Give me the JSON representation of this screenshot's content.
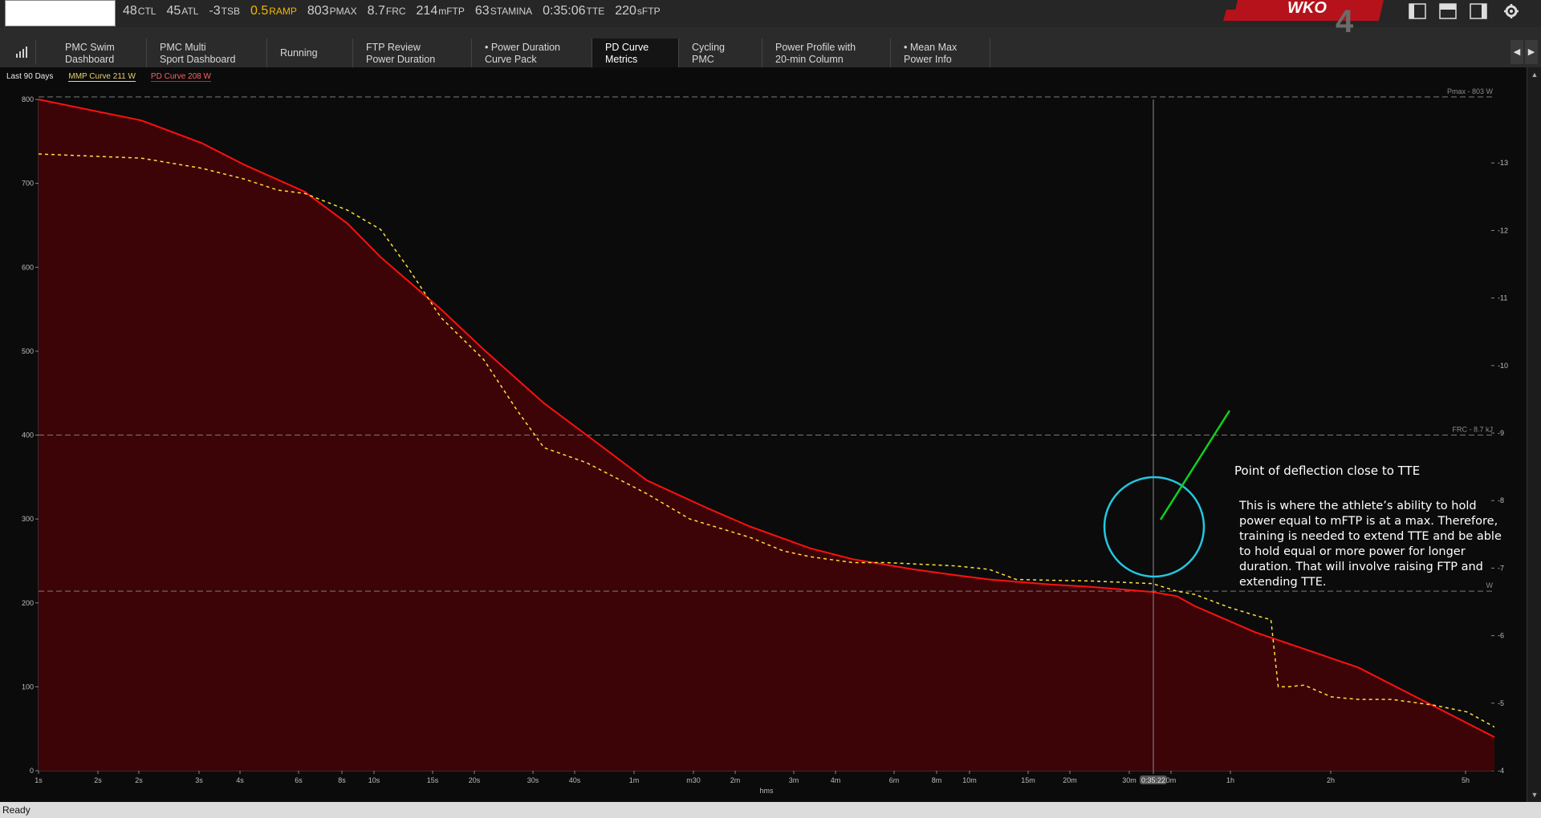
{
  "metrics": [
    {
      "value": "48",
      "unit": "CTL",
      "highlight": false
    },
    {
      "value": "45",
      "unit": "ATL",
      "highlight": false
    },
    {
      "value": "-3",
      "unit": "TSB",
      "highlight": false
    },
    {
      "value": "0.5",
      "unit": "RAMP",
      "highlight": true
    },
    {
      "value": "803",
      "unit": "PMAX",
      "highlight": false
    },
    {
      "value": "8.7",
      "unit": "FRC",
      "highlight": false
    },
    {
      "value": "214",
      "unit": "mFTP",
      "highlight": false
    },
    {
      "value": "63",
      "unit": "STAMINA",
      "highlight": false
    },
    {
      "value": "0:35:06",
      "unit": "TTE",
      "highlight": false
    },
    {
      "value": "220",
      "unit": "sFTP",
      "highlight": false
    }
  ],
  "logo_text": "WKO",
  "logo_number": "4",
  "tabs": [
    {
      "line1": "PMC Swim",
      "line2": "Dashboard",
      "active": false
    },
    {
      "line1": "PMC Multi",
      "line2": "Sport Dashboard",
      "active": false
    },
    {
      "line1": "Running",
      "line2": "",
      "active": false
    },
    {
      "line1": "FTP Review",
      "line2": "Power Duration",
      "active": false
    },
    {
      "line1": "• Power Duration",
      "line2": "Curve Pack",
      "active": false
    },
    {
      "line1": "PD Curve",
      "line2": "Metrics",
      "active": true
    },
    {
      "line1": "Cycling",
      "line2": "PMC",
      "active": false
    },
    {
      "line1": "Power Profile with",
      "line2": "20-min Column",
      "active": false
    },
    {
      "line1": "• Mean Max",
      "line2": "Power Info",
      "active": false
    }
  ],
  "legend": {
    "period": "Last 90 Days",
    "mmp": "MMP Curve 211 W",
    "pd": "PD Curve 208 W"
  },
  "annotation": {
    "title": "Point of deflection close to TTE",
    "body": "This is where the athlete’s ability to hold power equal to mFTP is at a max. Therefore, training is needed to extend TTE and be able to hold equal or more power for longer duration. That will involve raising FTP and extending TTE."
  },
  "status": "Ready",
  "colors": {
    "pd_curve": "#ff1010",
    "pd_fill": "#3d0407",
    "mmp_curve": "#ffe23a",
    "highlight_circle": "#22c8e0",
    "pointer_line": "#10d020",
    "ramp": "#f0b800"
  },
  "chart_data": {
    "type": "line",
    "xlabel": "hms",
    "x_scale": "log-duration",
    "x_tick_labels": [
      "1s",
      "2s",
      "2s",
      "3s",
      "4s",
      "6s",
      "8s",
      "10s",
      "15s",
      "20s",
      "30s",
      "40s",
      "1m",
      "m30",
      "2m",
      "3m",
      "4m",
      "6m",
      "8m",
      "10m",
      "15m",
      "20m",
      "30m",
      "0:35:22",
      "0m",
      "1h",
      "2h",
      "5h"
    ],
    "y_left_ticks": [
      0,
      100,
      200,
      300,
      400,
      500,
      600,
      700,
      800
    ],
    "y_right_ticks": [
      "-4",
      "-5",
      "-6",
      "-7",
      "-8",
      "-9",
      "-10",
      "-11",
      "-12",
      "-13"
    ],
    "ylim": [
      0,
      800
    ],
    "reference_lines": [
      {
        "label": "Pmax - 803 W",
        "value": 803
      },
      {
        "label": "FRC - 8.7 kJ",
        "value": 400
      },
      {
        "label": "W",
        "value": 214
      }
    ],
    "cursor_label": "0:35:22",
    "series": [
      {
        "name": "PD Curve 208 W",
        "duration_s": [
          1,
          2,
          3,
          4,
          6,
          8,
          10,
          15,
          20,
          30,
          40,
          60,
          90,
          120,
          180,
          240,
          360,
          480,
          600,
          900,
          1200,
          1800,
          2122,
          2400,
          3600,
          7200,
          18000
        ],
        "values": [
          800,
          775,
          748,
          722,
          690,
          652,
          612,
          550,
          502,
          438,
          400,
          346,
          313,
          291,
          265,
          252,
          240,
          233,
          228,
          222,
          219,
          213,
          208,
          196,
          165,
          123,
          40
        ]
      },
      {
        "name": "MMP Curve 211 W",
        "duration_s": [
          1,
          2,
          3,
          4,
          5,
          6,
          8,
          10,
          12,
          15,
          20,
          25,
          30,
          40,
          60,
          80,
          120,
          150,
          180,
          240,
          300,
          480,
          600,
          720,
          900,
          1200,
          1800,
          2122,
          2400,
          3000,
          3600,
          4000,
          4200,
          4500,
          5000,
          6000,
          7200,
          9000,
          12000,
          15000,
          18000
        ],
        "values": [
          735,
          730,
          718,
          705,
          692,
          688,
          668,
          645,
          600,
          540,
          490,
          430,
          385,
          367,
          330,
          300,
          278,
          262,
          255,
          248,
          248,
          244,
          240,
          228,
          227,
          226,
          223,
          214,
          210,
          195,
          185,
          180,
          100,
          100,
          102,
          88,
          85,
          85,
          78,
          70,
          52
        ]
      }
    ]
  }
}
